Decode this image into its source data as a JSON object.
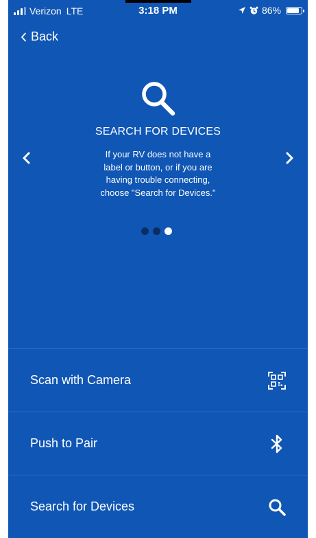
{
  "status_bar": {
    "carrier": "Verizon",
    "network": "LTE",
    "time": "3:18 PM",
    "battery_percent": "86%",
    "battery_level": 0.86
  },
  "nav": {
    "back_label": "Back"
  },
  "slide": {
    "icon": "search-icon",
    "title": "SEARCH FOR DEVICES",
    "description": "If your RV does not have a\nlabel or button, or if you are\nhaving trouble connecting,\nchoose \"Search for Devices.\"",
    "page_count": 3,
    "current_page": 3
  },
  "actions": [
    {
      "label": "Scan with Camera",
      "icon": "qr-code-icon"
    },
    {
      "label": "Push to Pair",
      "icon": "bluetooth-icon"
    },
    {
      "label": "Search for Devices",
      "icon": "search-icon"
    }
  ],
  "colors": {
    "background": "#1056b4",
    "divider": "#2a6cc4",
    "dot_inactive": "#0b2d63",
    "foreground": "#ffffff"
  }
}
